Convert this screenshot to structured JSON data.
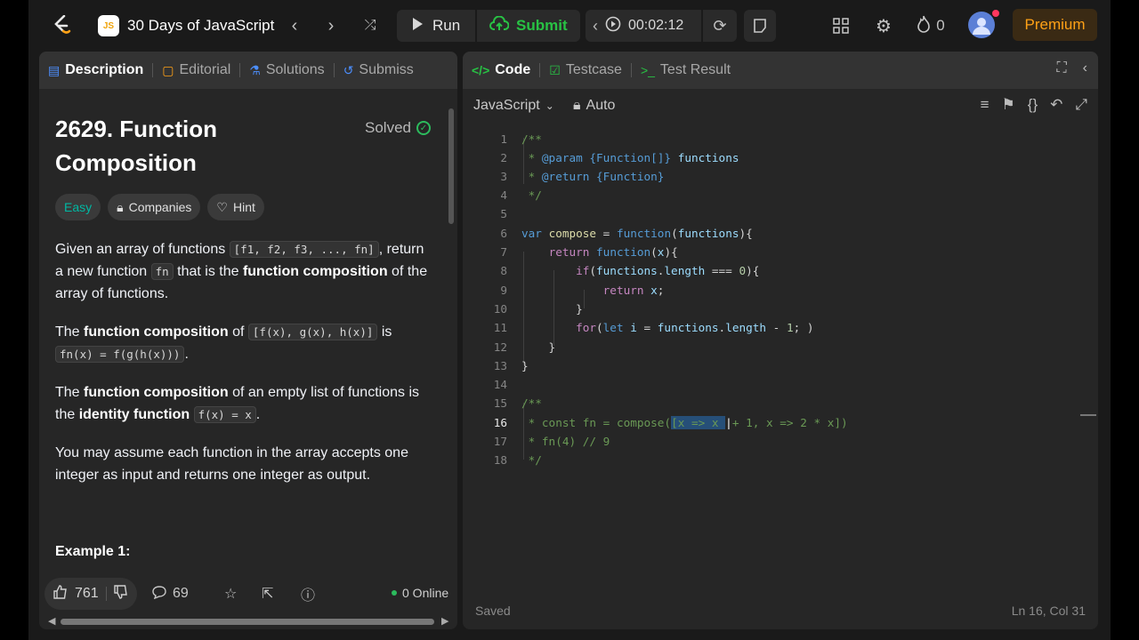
{
  "topbar": {
    "course_title": "30 Days of JavaScript",
    "js_badge": "JS",
    "run_label": "Run",
    "submit_label": "Submit",
    "timer": "00:02:12",
    "streak_count": "0",
    "premium_label": "Premium"
  },
  "left": {
    "tabs": [
      "Description",
      "Editorial",
      "Solutions",
      "Submiss"
    ],
    "title_line1": "2629. Function",
    "title_line2": "Composition",
    "solved_label": "Solved",
    "chips": {
      "difficulty": "Easy",
      "companies": "Companies",
      "hint": "Hint"
    },
    "desc": {
      "p1_a": "Given an array of functions ",
      "p1_code1": "[f1, f2, f3, ..., fn]",
      "p1_b": ", return a new function ",
      "p1_code2": "fn",
      "p1_c": " that is the ",
      "p1_bold": "function composition",
      "p1_d": " of the array of functions.",
      "p2_a": "The ",
      "p2_bold": "function composition",
      "p2_b": " of ",
      "p2_code1": "[f(x), g(x), h(x)]",
      "p2_c": " is ",
      "p2_code2": "fn(x) = f(g(h(x)))",
      "p2_d": ".",
      "p3_a": "The ",
      "p3_bold": "function composition",
      "p3_b": " of an empty list of functions is the ",
      "p3_bold2": "identity function",
      "p3_c": " ",
      "p3_code": "f(x) = x",
      "p3_d": ".",
      "p4": "You may assume each function in the array accepts one integer as input and returns one integer as output."
    },
    "example_heading": "Example 1:",
    "footer": {
      "likes": "761",
      "comments": "69",
      "online": "0 Online"
    }
  },
  "right": {
    "tabs": [
      "Code",
      "Testcase",
      "Test Result"
    ],
    "language": "JavaScript",
    "auto_label": "Auto",
    "status_saved": "Saved",
    "cursor_pos": "Ln 16, Col 31",
    "line_numbers": [
      "1",
      "2",
      "3",
      "4",
      "5",
      "6",
      "7",
      "8",
      "9",
      "10",
      "11",
      "12",
      "13",
      "14",
      "15",
      "16",
      "17",
      "18"
    ]
  },
  "colors": {
    "accent": "#ffa116",
    "submit_green": "#28c244",
    "easy": "#00b8a3"
  },
  "icons": [
    "leetcode-logo-icon",
    "chevron-left-icon",
    "chevron-right-icon",
    "shuffle-icon",
    "play-icon",
    "cloud-upload-icon",
    "clock-icon",
    "refresh-icon",
    "note-icon",
    "layout-icon",
    "gear-icon",
    "flame-icon",
    "avatar-icon",
    "description-icon",
    "editorial-icon",
    "solutions-icon",
    "submissions-icon",
    "check-circle-icon",
    "lock-icon",
    "bulb-icon",
    "thumbs-up-icon",
    "thumbs-down-icon",
    "comment-icon",
    "star-icon",
    "share-icon",
    "help-icon",
    "code-icon",
    "testcase-icon",
    "terminal-icon",
    "expand-icon",
    "collapse-icon",
    "format-icon",
    "bookmark-icon",
    "braces-icon",
    "undo-icon",
    "fullscreen-icon"
  ]
}
